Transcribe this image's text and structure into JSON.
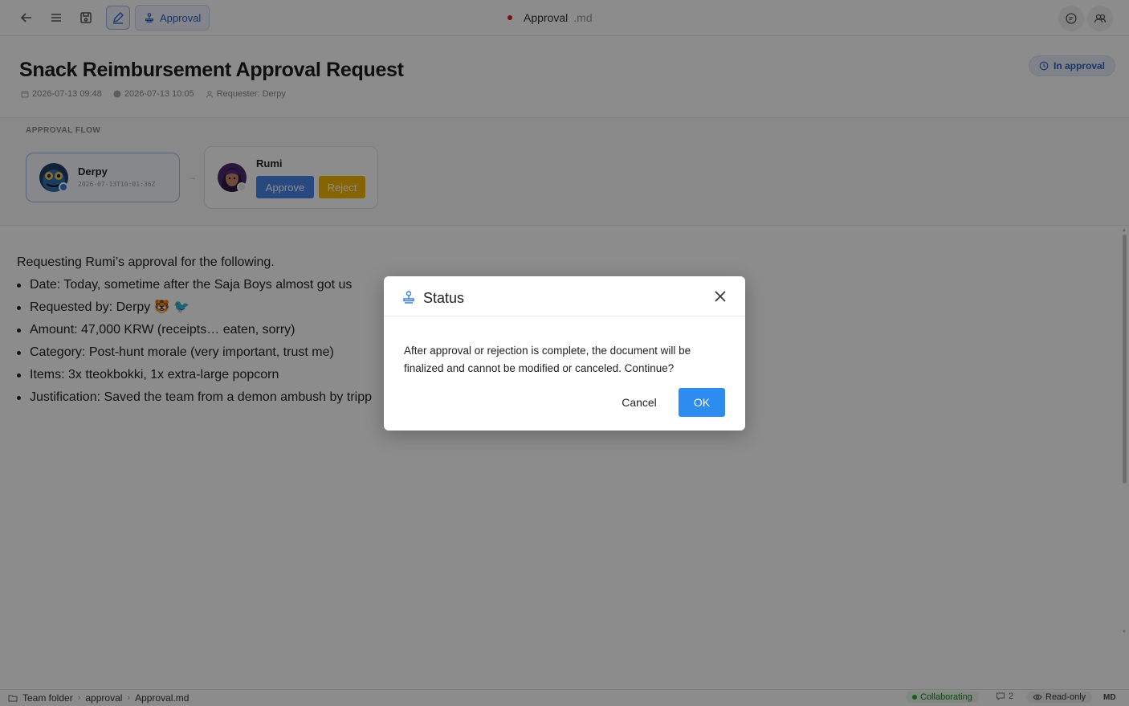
{
  "toolbar": {
    "approval_chip_label": "Approval",
    "doc_name": "Approval",
    "doc_ext": ".md"
  },
  "header": {
    "title": "Snack Reimbursement Approval Request",
    "created": "2026-07-13 09:48",
    "updated": "2026-07-13 10:05",
    "requester": "Requester: Derpy",
    "status": "In approval"
  },
  "flow": {
    "label": "APPROVAL FLOW",
    "steps": [
      {
        "name": "Derpy",
        "time": "2026-07-13T10:01:36Z"
      },
      {
        "name": "Rumi",
        "approve_label": "Approve",
        "reject_label": "Reject"
      }
    ],
    "arrow": "→"
  },
  "content": {
    "intro": "Requesting Rumi’s approval for the following.",
    "items": [
      "Date: Today, sometime after the Saja Boys almost got us",
      "Requested by: Derpy 🐯 🐦",
      "Amount: 47,000 KRW (receipts… eaten, sorry)",
      "Category: Post-hunt morale (very important, trust me)",
      "Items: 3x tteokbokki, 1x extra-large popcorn",
      "Justification: Saved the team from a demon ambush by tripp"
    ]
  },
  "statusbar": {
    "crumbs": [
      "Team folder",
      "approval",
      "Approval.md"
    ],
    "collab": "Collaborating",
    "comments": "2",
    "readonly": "Read-only",
    "format": "MD"
  },
  "modal": {
    "title": "Status",
    "body": "After approval or rejection is complete, the document will be finalized and cannot be modified or canceled. Continue?",
    "cancel": "Cancel",
    "ok": "OK"
  },
  "colors": {
    "accent": "#2d8cf0",
    "approve": "#4a86e8",
    "reject": "#f5b800",
    "status_text": "#2f5fbf",
    "collab_dot": "#2ca53c"
  }
}
